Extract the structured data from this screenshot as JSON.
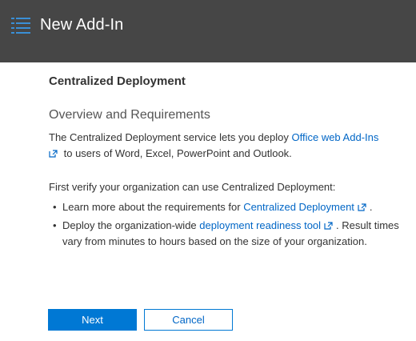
{
  "header": {
    "title": "New Add-In",
    "icon": "list-icon"
  },
  "main": {
    "section_title": "Centralized Deployment",
    "subtitle": "Overview and Requirements",
    "intro_prefix": "The Centralized Deployment service lets you deploy ",
    "intro_link": "Office web Add-Ins",
    "intro_suffix": " to users of Word, Excel, PowerPoint and Outlook.",
    "verify_text": "First verify your organization can use Centralized Deployment:",
    "bullets": [
      {
        "prefix": "Learn more about the requirements for ",
        "link": "Centralized Deployment",
        "suffix": "."
      },
      {
        "prefix": "Deploy the organization-wide ",
        "link": "deployment readiness tool",
        "suffix": ". Result times vary from minutes to hours based on the size of your organization."
      }
    ]
  },
  "buttons": {
    "next_label": "Next",
    "cancel_label": "Cancel"
  },
  "colors": {
    "header_bg": "#464646",
    "accent": "#0078d4",
    "link": "#0066c6"
  }
}
